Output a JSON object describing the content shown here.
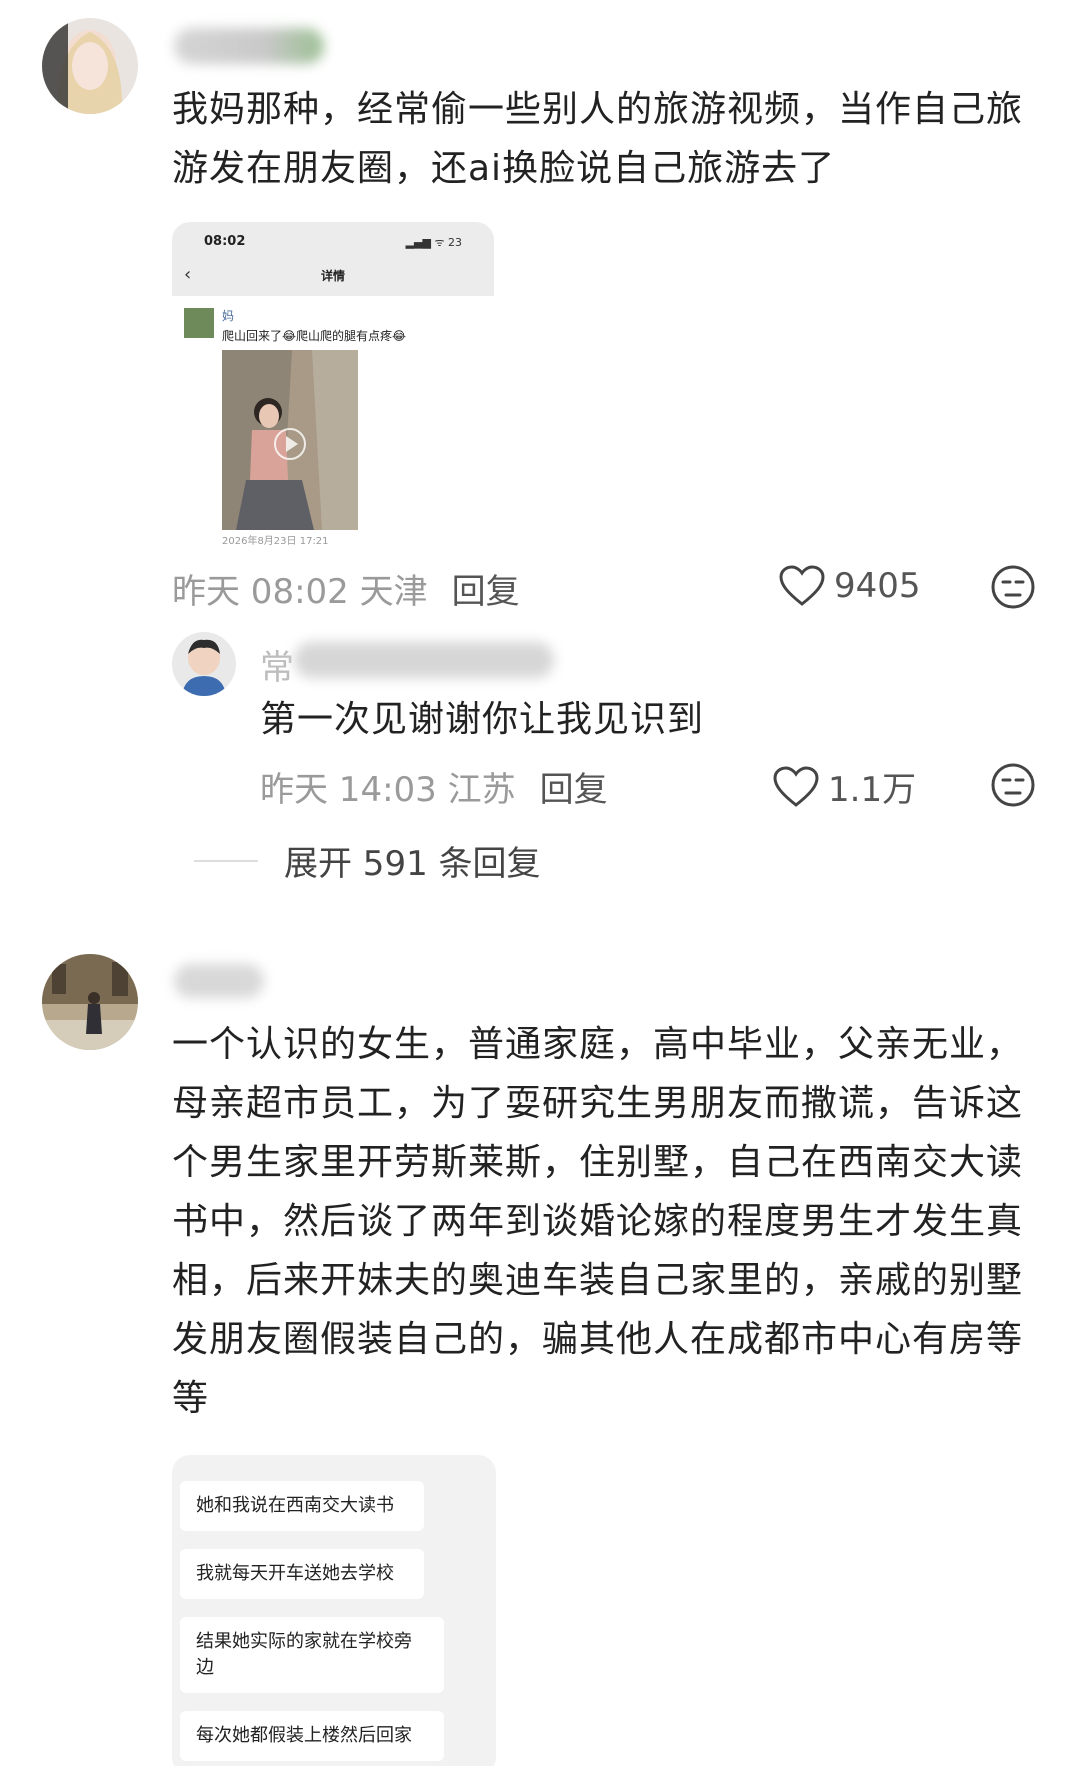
{
  "comment1": {
    "text": "我妈那种，经常偷一些别人的旅游视频，当作自己旅游发在朋友圈，还ai换脸说自己旅游去了",
    "meta_time_location": "昨天 08:02 天津",
    "reply_label": "回复",
    "likes": "9405",
    "screenshot": {
      "status_time": "08:02",
      "status_icons": "▂▄▆ ᯤ 23",
      "back_icon": "‹",
      "title": "详情",
      "poster_name": "妈",
      "post_text": "爬山回来了😂爬山爬的腿有点疼😂",
      "post_date": "2026年8月23日 17:21"
    }
  },
  "reply1": {
    "name_visible_char": "常",
    "text": "第一次见谢谢你让我见识到",
    "meta_time_location": "昨天 14:03 江苏",
    "reply_label": "回复",
    "likes": "1.1万"
  },
  "expand_replies": "展开 591 条回复",
  "comment2": {
    "text": "一个认识的女生，普通家庭，高中毕业，父亲无业，母亲超市员工，为了耍研究生男朋友而撒谎，告诉这个男生家里开劳斯莱斯，住别墅，自己在西南交大读书中，然后谈了两年到谈婚论嫁的程度男生才发生真相，后来开妹夫的奥迪车装自己家里的，亲戚的别墅发朋友圈假装自己的，骗其他人在成都市中心有房等等",
    "chat_messages": [
      "她和我说在西南交大读书",
      "我就每天开车送她去学校",
      "结果她实际的家就在学校旁边",
      "每次她都假装上楼然后回家"
    ]
  },
  "icons": {
    "like": "heart-outline-icon",
    "dislike": "unamused-face-icon"
  }
}
